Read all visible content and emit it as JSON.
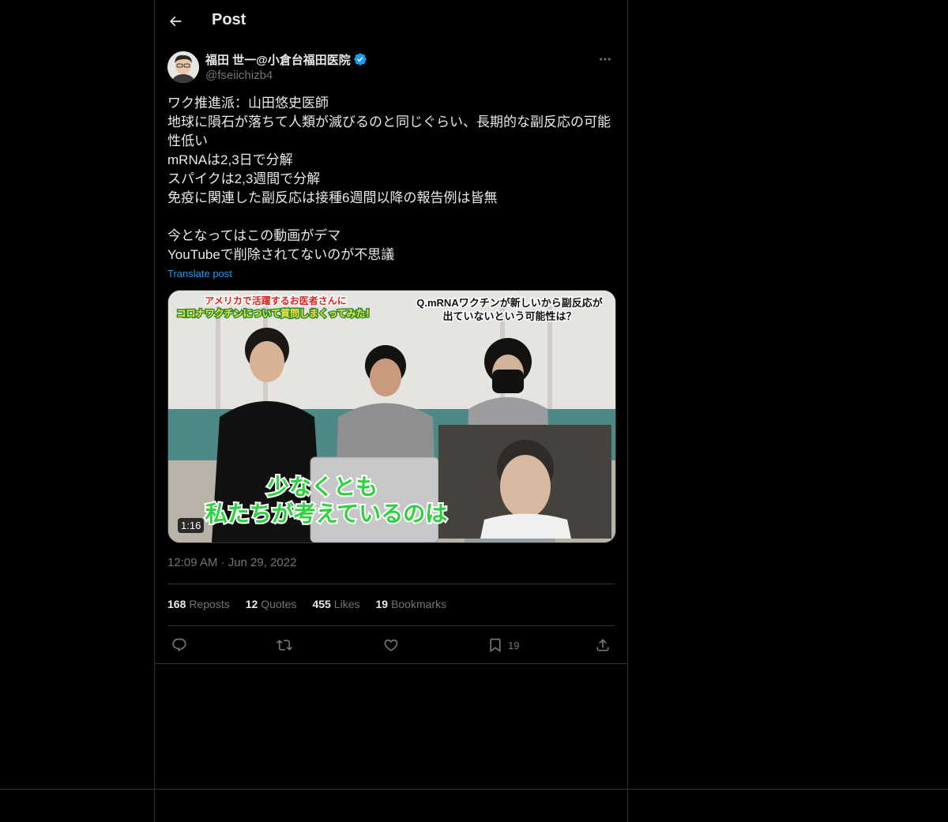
{
  "header": {
    "title": "Post"
  },
  "author": {
    "display_name": "福田 世一@小倉台福田医院",
    "handle": "@fseiichizb4"
  },
  "post": {
    "text": "ワク推進派：山田悠史医師\n地球に隕石が落ちて人類が滅びるのと同じぐらい、長期的な副反応の可能性低い\nmRNAは2,3日で分解\nスパイクは2,3週間で分解\n免疫に関連した副反応は接種6週間以降の報告例は皆無\n\n今となってはこの動画がデマ\nYouTubeで削除されてないのが不思議",
    "translate_label": "Translate post",
    "timestamp": "12:09 AM · Jun 29, 2022"
  },
  "media": {
    "caption_top_left_1": "アメリカで活躍するお医者さんに",
    "caption_top_left_2": "コロナワクチンについて質問しまくってみた！",
    "caption_top_right_1": "Q.mRNAワクチンが新しいから副反応が",
    "caption_top_right_2": "出ていないという可能性は？",
    "subtitle_1": "少なくとも",
    "subtitle_2": "私たちが考えているのは",
    "duration": "1:16"
  },
  "stats": {
    "reposts_count": "168",
    "reposts_label": "Reposts",
    "quotes_count": "12",
    "quotes_label": "Quotes",
    "likes_count": "455",
    "likes_label": "Likes",
    "bookmarks_count": "19",
    "bookmarks_label": "Bookmarks"
  },
  "actions": {
    "bookmark_count": "19"
  },
  "colors": {
    "accent": "#1d9bf0",
    "background": "#000000",
    "border": "#2f3336",
    "muted": "#71767b"
  }
}
